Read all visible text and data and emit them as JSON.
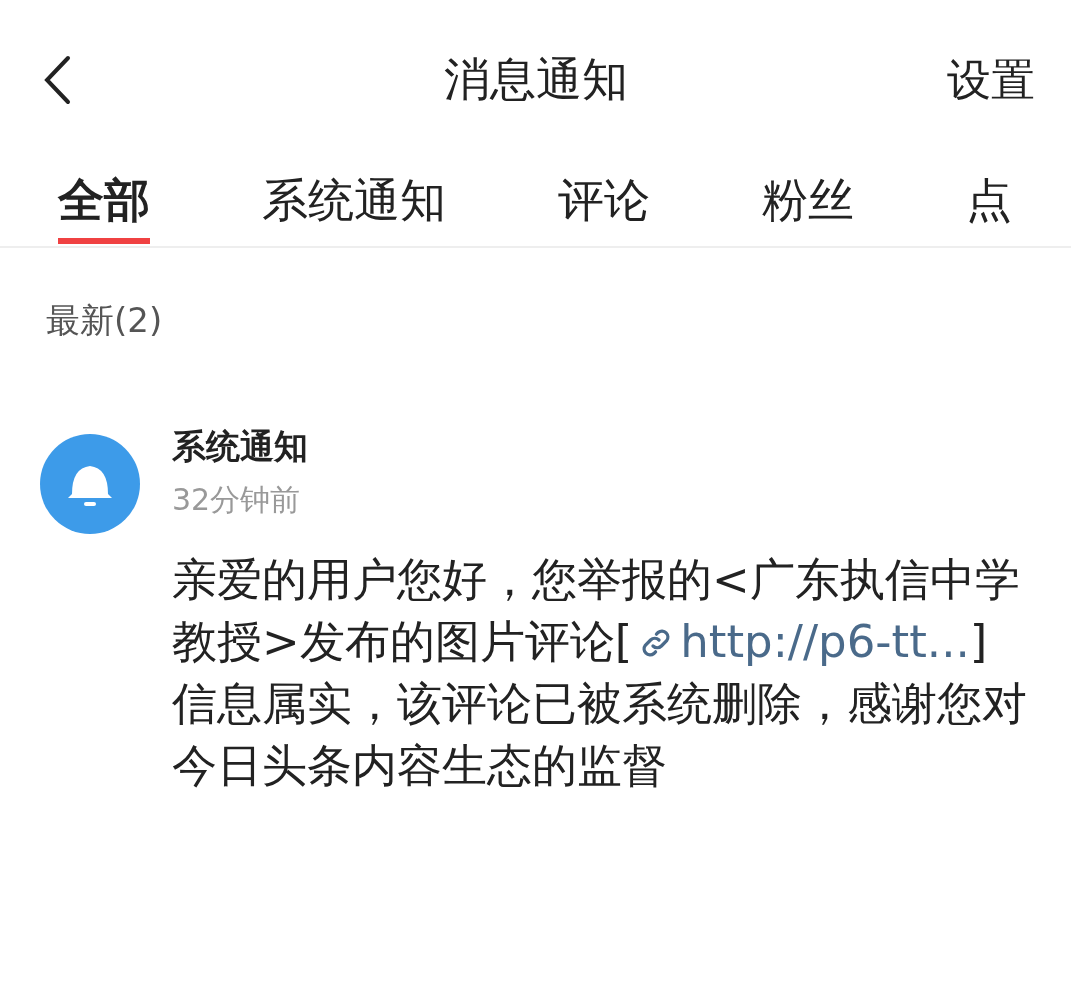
{
  "header": {
    "title": "消息通知",
    "action": "设置"
  },
  "tabs": [
    {
      "label": "全部",
      "selected": true
    },
    {
      "label": "系统通知",
      "selected": false
    },
    {
      "label": "评论",
      "selected": false
    },
    {
      "label": "粉丝",
      "selected": false
    },
    {
      "label": "点",
      "selected": false
    }
  ],
  "section": {
    "title": "最新(2)"
  },
  "notification": {
    "sender": "系统通知",
    "time": "32分钟前",
    "message": [
      {
        "kind": "text",
        "text": "亲爱的用户您好，您举报的<广东执信中学教授>发布的图片评论["
      },
      {
        "kind": "link",
        "text": "http://p6-tt..."
      },
      {
        "kind": "text",
        "text": "]信息属实，该评论已被系统删除，感谢您对今日头条内容生态的监督"
      }
    ]
  }
}
